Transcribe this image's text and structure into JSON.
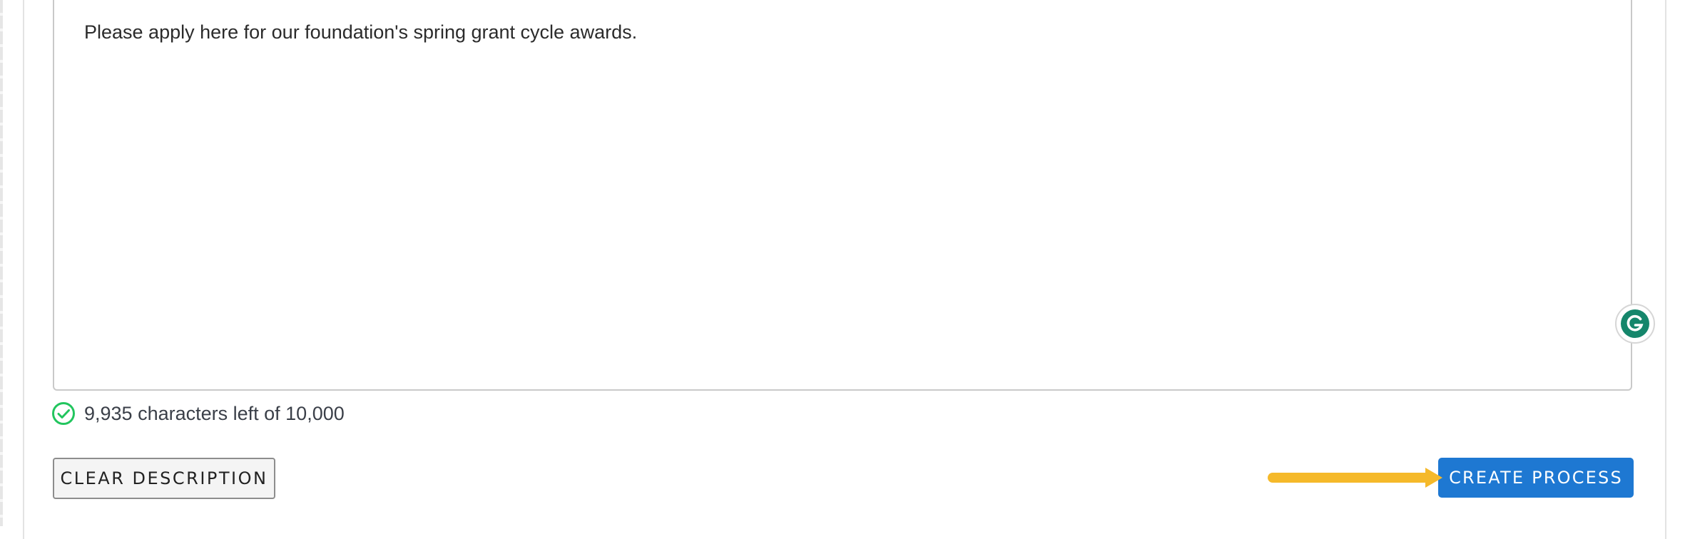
{
  "editor": {
    "text": "Please apply here for our foundation's spring grant cycle awards."
  },
  "counter": {
    "text": "9,935 characters left of 10,000"
  },
  "buttons": {
    "clear_label": "CLEAR DESCRIPTION",
    "create_label": "CREATE PROCESS"
  },
  "icons": {
    "counter_status": "check-circle-icon",
    "grammarly": "grammarly-icon",
    "annotation": "arrow-right-icon"
  },
  "colors": {
    "primary_button": "#1e78d2",
    "check_green": "#22c55e",
    "annotation_arrow": "#f5b92a",
    "grammarly_green": "#15866b"
  }
}
